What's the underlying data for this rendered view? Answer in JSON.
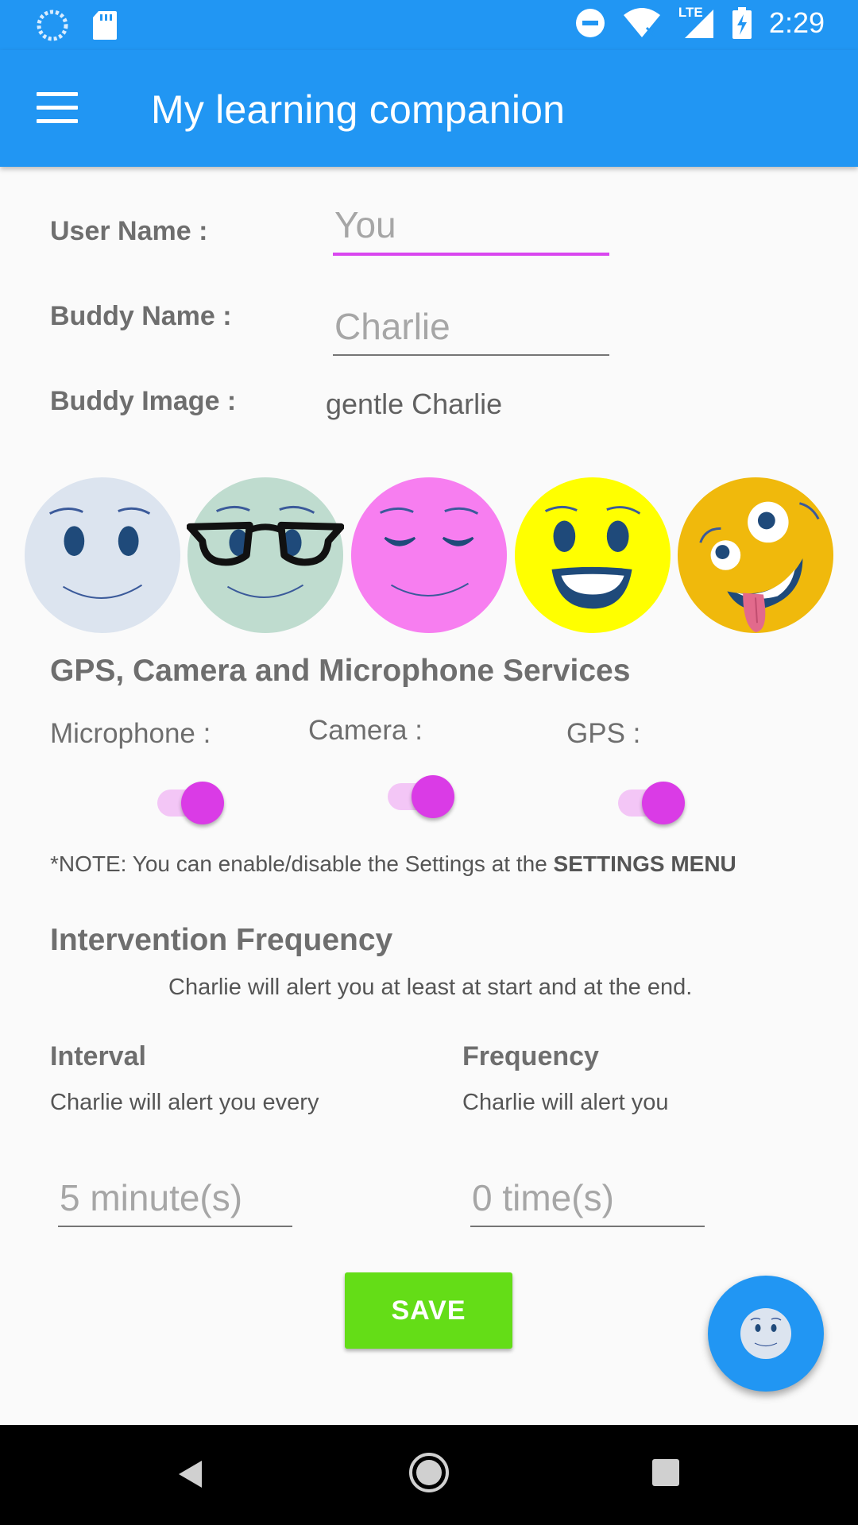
{
  "status_bar": {
    "time": "2:29",
    "left_icons": [
      "loading-circle-icon",
      "sd-card-icon"
    ],
    "right_icons": [
      "do-not-disturb-icon",
      "wifi-icon",
      "lte-signal-icon",
      "battery-charging-icon"
    ],
    "lte_text": "LTE"
  },
  "app_bar": {
    "title": "My learning companion",
    "menu_icon": "hamburger-menu-icon",
    "background": "#2196f3"
  },
  "form": {
    "user_name_label": "User Name :",
    "user_name_placeholder": "You",
    "buddy_name_label": "Buddy Name :",
    "buddy_name_placeholder": "Charlie",
    "buddy_image_label": "Buddy Image :",
    "buddy_image_value": "gentle Charlie"
  },
  "buddy_images": [
    {
      "name": "gentle-face",
      "color": "#dce4ef"
    },
    {
      "name": "glasses-face",
      "color": "#bfdccf"
    },
    {
      "name": "sleepy-face",
      "color": "#f77ef0"
    },
    {
      "name": "smiling-face",
      "color": "#ffff00"
    },
    {
      "name": "crazy-face",
      "color": "#f0b90c"
    }
  ],
  "services": {
    "title": "GPS, Camera and Microphone Services",
    "microphone_label": "Microphone :",
    "camera_label": "Camera :",
    "gps_label": "GPS :",
    "microphone_on": true,
    "camera_on": true,
    "gps_on": true,
    "note_prefix": "*NOTE: You can enable/disable the Settings at the ",
    "note_bold": "SETTINGS MENU"
  },
  "intervention": {
    "title": "Intervention Frequency",
    "subtitle": "Charlie will alert you at least at start and at the end.",
    "interval_label": "Interval",
    "interval_desc": "Charlie will alert you every",
    "interval_placeholder": "5 minute(s)",
    "frequency_label": "Frequency",
    "frequency_desc": "Charlie will alert you",
    "frequency_placeholder": "0 time(s)"
  },
  "save_label": "SAVE",
  "colors": {
    "accent": "#d946ef",
    "save": "#64dd17",
    "primary": "#2196f3"
  },
  "nav_bar": {
    "icons": [
      "back-icon",
      "home-icon",
      "recents-icon"
    ]
  }
}
